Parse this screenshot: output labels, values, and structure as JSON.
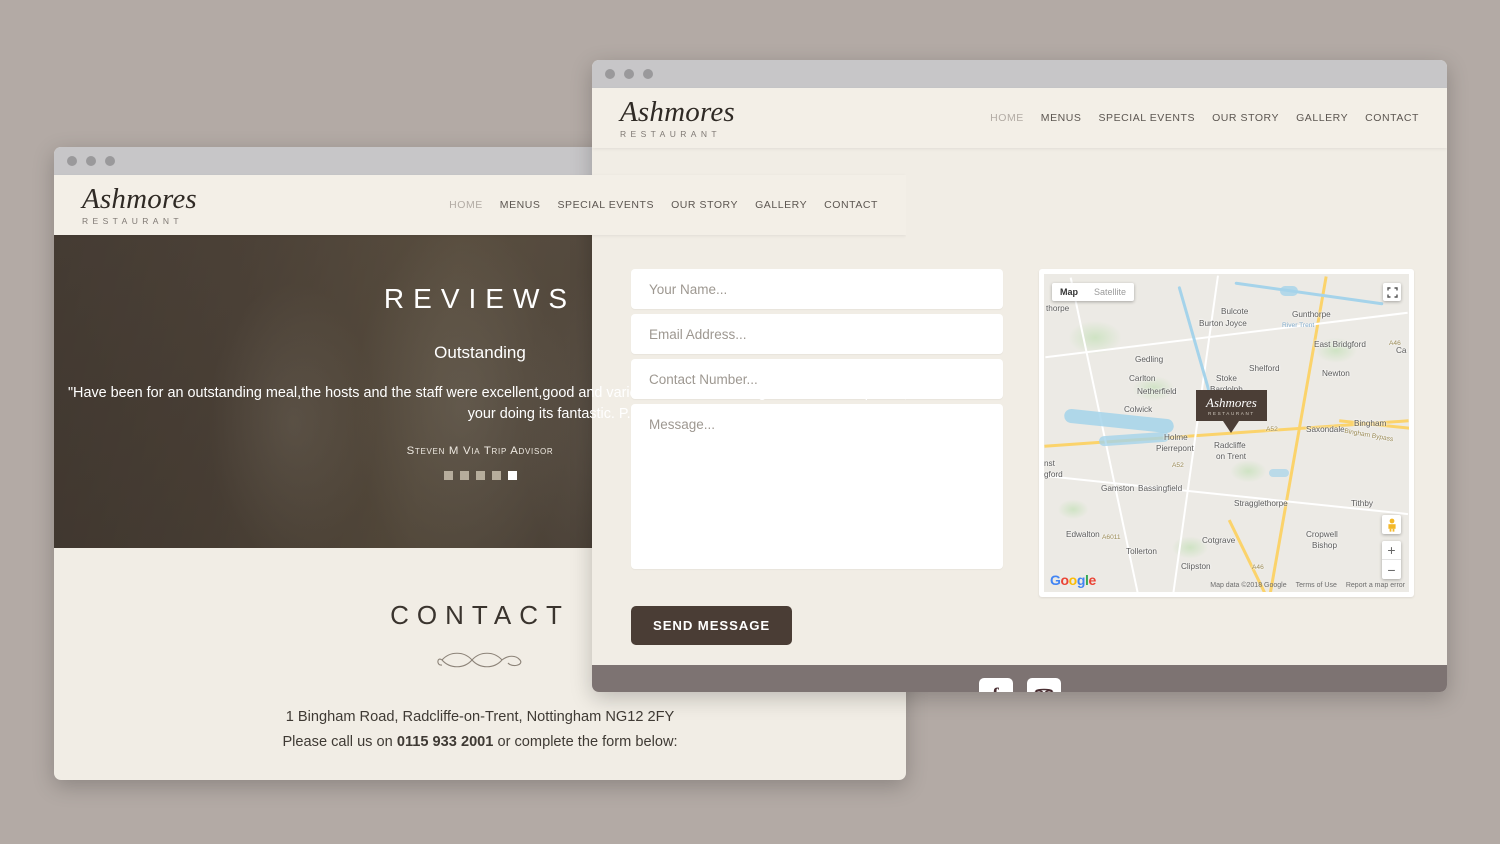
{
  "background_color": "#b3aaa5",
  "back_window": {
    "name": "ashmores-contact-page-window",
    "titlebar_dots": 3,
    "brand": {
      "name": "Ashmores",
      "sub": "RESTAURANT"
    },
    "nav": [
      {
        "label": "HOME",
        "muted": true
      },
      {
        "label": "MENUS",
        "muted": false
      },
      {
        "label": "SPECIAL EVENTS",
        "muted": false
      },
      {
        "label": "OUR STORY",
        "muted": false
      },
      {
        "label": "GALLERY",
        "muted": false
      },
      {
        "label": "CONTACT",
        "muted": false
      }
    ],
    "hero": {
      "title": "REVIEWS",
      "subtitle": "Outstanding",
      "quote": "\"Have been for an outstanding meal,the hosts and the staff were excellent,good and varied choice, booked again and will keep doing so,keep doing what your doing its fantastic. P.S",
      "attribution": "Steven M Via Trip Advisor",
      "carousel_dots": 5,
      "carousel_active_index": 4
    },
    "contact": {
      "title": "CONTACT",
      "address": "1 Bingham Road, Radcliffe-on-Trent, Nottingham NG12 2FY",
      "call_prefix": "Please call us on ",
      "phone": "0115 933 2001",
      "call_suffix": " or complete the form below:"
    }
  },
  "front_window": {
    "name": "ashmores-contact-form-window",
    "titlebar_dots": 3,
    "brand": {
      "name": "Ashmores",
      "sub": "RESTAURANT"
    },
    "nav": [
      {
        "label": "HOME",
        "muted": true
      },
      {
        "label": "MENUS",
        "muted": false
      },
      {
        "label": "SPECIAL EVENTS",
        "muted": false
      },
      {
        "label": "OUR STORY",
        "muted": false
      },
      {
        "label": "GALLERY",
        "muted": false
      },
      {
        "label": "CONTACT",
        "muted": false
      }
    ],
    "form": {
      "name_placeholder": "Your Name...",
      "email_placeholder": "Email Address...",
      "phone_placeholder": "Contact Number...",
      "message_placeholder": "Message...",
      "name_value": "",
      "email_value": "",
      "phone_value": "",
      "message_value": "",
      "submit_label": "SEND MESSAGE",
      "submit_color": "#4a3d35"
    },
    "map": {
      "type_toggle": {
        "map": "Map",
        "satellite": "Satellite",
        "active": "Map"
      },
      "marker": {
        "name": "Ashmores",
        "sub": "RESTAURANT"
      },
      "zoom_in": "+",
      "zoom_out": "−",
      "google_logo": "Google",
      "attribution": [
        "Map data ©2018 Google",
        "Terms of Use",
        "Report a map error"
      ],
      "place_labels": [
        "Bulcote",
        "Burton Joyce",
        "Gunthorpe",
        "East Bridgford",
        "Gedling",
        "Shelford",
        "Newton",
        "Carlton",
        "Netherfield",
        "Stoke",
        "Bardolph",
        "Colwick",
        "Saxondale",
        "Bingham",
        "Holme",
        "Pierrepont",
        "Radcliffe",
        "on Trent",
        "Gamston",
        "Bassingfield",
        "Stragglethorpe",
        "Tithby",
        "Edwalton",
        "Cotgrave",
        "Cropwell",
        "Bishop",
        "Tollerton",
        "Clipston",
        "thorpe",
        "Ca",
        "nst",
        "gford"
      ],
      "road_labels": [
        "A52",
        "A52",
        "A46",
        "A46",
        "A6011",
        "Bingham Bypass",
        "River Trent"
      ]
    },
    "footer": {
      "background": "#7d7372",
      "social": [
        {
          "name": "facebook",
          "glyph": "f"
        },
        {
          "name": "tripadvisor",
          "glyph": "owl"
        }
      ]
    }
  }
}
